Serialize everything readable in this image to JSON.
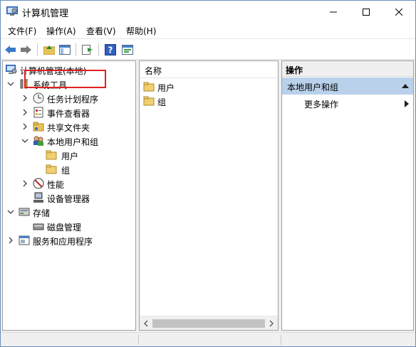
{
  "window": {
    "title": "计算机管理",
    "controls": {
      "minimize": "—",
      "maximize": "☐",
      "close": "✕"
    }
  },
  "menu": {
    "items": [
      "文件(F)",
      "操作(A)",
      "查看(V)",
      "帮助(H)"
    ]
  },
  "toolbar": {
    "buttons": [
      "back-arrow-icon",
      "forward-arrow-icon",
      "up-folder-icon",
      "show-tree-icon",
      "export-list-icon",
      "help-icon",
      "properties-icon"
    ]
  },
  "tree": {
    "root": "计算机管理(本地)",
    "system_tools": "系统工具",
    "task_scheduler": "任务计划程序",
    "event_viewer": "事件查看器",
    "shared_folders": "共享文件夹",
    "local_users_groups": "本地用户和组",
    "users": "用户",
    "groups": "组",
    "performance": "性能",
    "device_manager": "设备管理器",
    "storage": "存储",
    "disk_management": "磁盘管理",
    "services_apps": "服务和应用程序"
  },
  "list": {
    "column_header": "名称",
    "items": [
      "用户",
      "组"
    ]
  },
  "actions": {
    "header": "操作",
    "section_title": "本地用户和组",
    "more_actions": "更多操作"
  },
  "colors": {
    "accent_selected": "#b9d1ea",
    "highlight_border": "#e02020",
    "folder": "#e8c35a"
  }
}
